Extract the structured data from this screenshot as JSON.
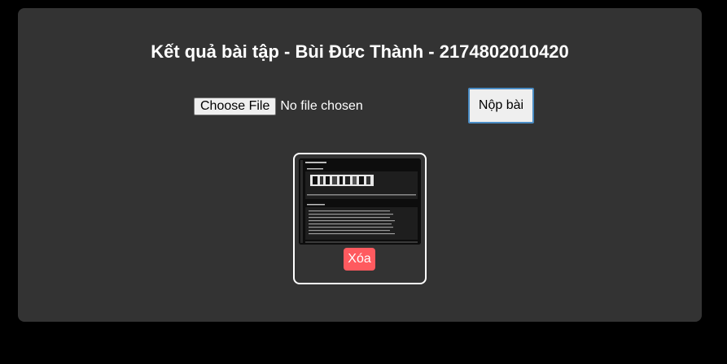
{
  "page": {
    "title": "Kết quả bài tập - Bùi Đức Thành - 2174802010420"
  },
  "upload": {
    "choose_label": "Choose File",
    "status": "No file chosen",
    "submit_label": "Nộp bài"
  },
  "submission": {
    "delete_label": "Xóa"
  },
  "colors": {
    "page_bg": "#000000",
    "panel_bg": "#333333",
    "delete_bg": "#ff5a5f",
    "submit_border": "#4a8cc4"
  }
}
